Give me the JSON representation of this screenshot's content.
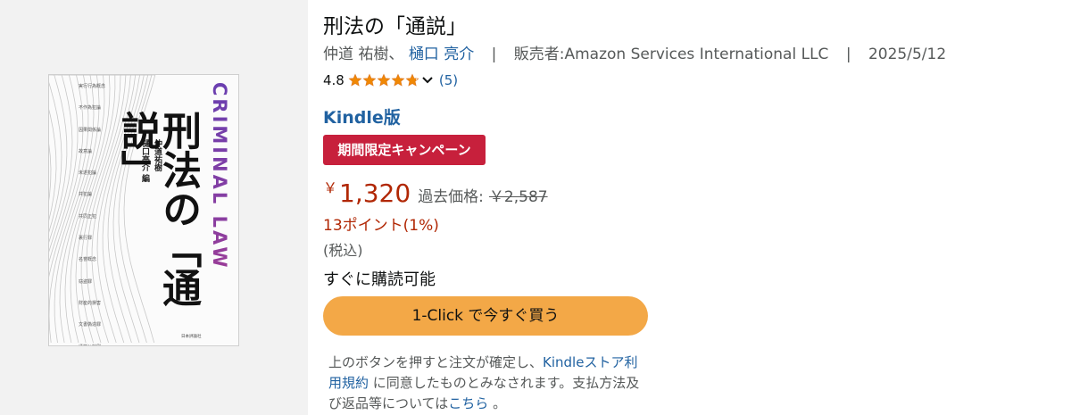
{
  "cover": {
    "title_line1": "刑法の",
    "title_line2": "「通説」",
    "authors": [
      "仲道祐樹",
      "樋口亮介 編"
    ],
    "english_title": "CRIMINAL LAW",
    "publisher": "日本評論社",
    "topics": [
      "実行行為概念",
      "不作為犯論",
      "因果関係論",
      "故意論",
      "未遂犯論",
      "共犯論",
      "共同正犯",
      "裏行罪",
      "名誉概念",
      "窃盗罪",
      "財産的損害",
      "文書偽造罪",
      "通説と判例"
    ]
  },
  "product": {
    "title": "刑法の「通説」",
    "author1": "仲道 祐樹、",
    "author2": "樋口 亮介",
    "separator": "|",
    "seller": "販売者:Amazon Services International LLC",
    "date": "2025/5/12"
  },
  "rating": {
    "value": "4.8",
    "stars": 4.8,
    "count": "(5)"
  },
  "format": "Kindle版",
  "badge": "期間限定キャンペーン",
  "price": {
    "currency": "￥",
    "amount": "1,320",
    "list_label": "過去価格:",
    "list_value": "￥2,587"
  },
  "points": "13ポイント(1%)",
  "tax": "(税込)",
  "availability": "すぐに購読可能",
  "buy_button": "1-Click で今すぐ買う",
  "notice": {
    "part1": "上のボタンを押すと注文が確定し、",
    "link1": "Kindleストア利用規約",
    "part2": "に同意したものとみなされます。支払方法及び返品等については",
    "link2": "こちら",
    "part3": "。"
  },
  "colors": {
    "star": "#f08804",
    "badge": "#c7203c",
    "price": "#b12704",
    "link": "#2162a1",
    "button": "#f3a847"
  }
}
